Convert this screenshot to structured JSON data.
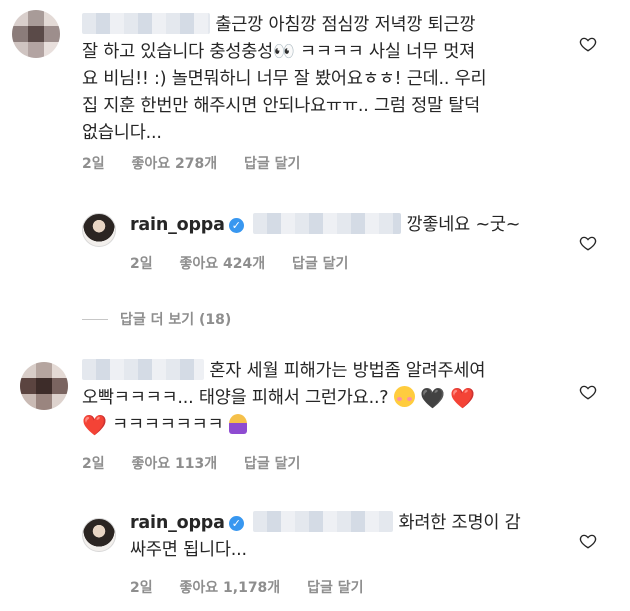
{
  "comments": [
    {
      "lines": [
        "출근깡 아침깡 점심깡 저녁깡 퇴근깡",
        "잘 하고 있습니다 충성충성",
        "요 비님!! :) 놀면뭐하니 너무 잘 봤어요ㅎㅎ! 근데.. 우리",
        "집 지훈 한번만 해주시면 안되나요ㅠㅠ.. 그럼 정말 탈덕",
        "없습니다..."
      ],
      "line2_tail": "ㅋㅋㅋㅋ 사실 너무 멋져",
      "emoji_eyes": "👀",
      "time": "2일",
      "likes": "좋아요 278개",
      "reply": "답글 달기"
    },
    {
      "username": "rain_oppa",
      "verified_mark": "✓",
      "text": "깡좋네요 ~굿~",
      "time": "2일",
      "likes": "좋아요 424개",
      "reply": "답글 달기"
    },
    {
      "more_replies": "답글 더 보기 (18)"
    },
    {
      "line1": "혼자 세월 피해가는 방법좀 알려주세여",
      "line2": "오빡ㅋㅋㅋㅋ... 태양을 피해서 그런가요..?",
      "line3": "ㅋㅋㅋㅋㅋㅋㅋ",
      "emoji_black_heart": "🖤",
      "emoji_red_heart": "❤️",
      "time": "2일",
      "likes": "좋아요 113개",
      "reply": "답글 달기"
    },
    {
      "username": "rain_oppa",
      "verified_mark": "✓",
      "line1": "화려한 조명이 감",
      "line2": "싸주면 됩니다...",
      "time": "2일",
      "likes": "좋아요 1,178개",
      "reply": "답글 달기"
    }
  ],
  "icons": {
    "heart": "heart-outline-icon"
  },
  "colors": {
    "meta_gray": "#8e8e8e",
    "verified_blue": "#3897f0",
    "text": "#262626"
  }
}
